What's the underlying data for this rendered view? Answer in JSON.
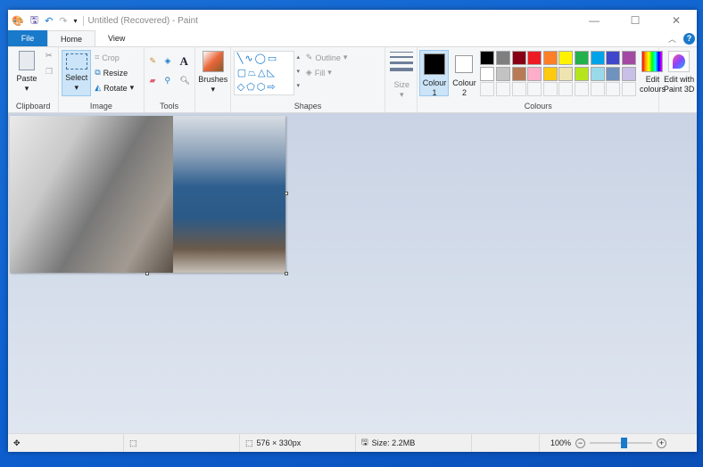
{
  "title": "Untitled (Recovered) - Paint",
  "tabs": {
    "file": "File",
    "home": "Home",
    "view": "View"
  },
  "clipboard": {
    "paste": "Paste",
    "label": "Clipboard"
  },
  "image": {
    "select": "Select",
    "crop": "Crop",
    "resize": "Resize",
    "rotate": "Rotate",
    "label": "Image"
  },
  "tools": {
    "label": "Tools"
  },
  "brushes": {
    "label": "Brushes"
  },
  "shapes": {
    "outline": "Outline",
    "fill": "Fill",
    "label": "Shapes"
  },
  "size": {
    "label": "Size"
  },
  "colours": {
    "colour1": "Colour",
    "colour1_n": "1",
    "colour2": "Colour",
    "colour2_n": "2",
    "edit": "Edit",
    "edit2": "colours",
    "label": "Colours",
    "row1": [
      "#000000",
      "#7f7f7f",
      "#880015",
      "#ed1c24",
      "#ff7f27",
      "#fff200",
      "#22b14c",
      "#00a2e8",
      "#3f48cc",
      "#a349a4"
    ],
    "row2": [
      "#ffffff",
      "#c3c3c3",
      "#b97a57",
      "#ffaec9",
      "#ffc90e",
      "#efe4b0",
      "#b5e61d",
      "#99d9ea",
      "#7092be",
      "#c8bfe7"
    ]
  },
  "paint3d": {
    "line1": "Edit with",
    "line2": "Paint 3D"
  },
  "status": {
    "dimensions": "576 × 330px",
    "size": "Size: 2.2MB",
    "zoom": "100%",
    "zoom_fraction": 0.55
  }
}
